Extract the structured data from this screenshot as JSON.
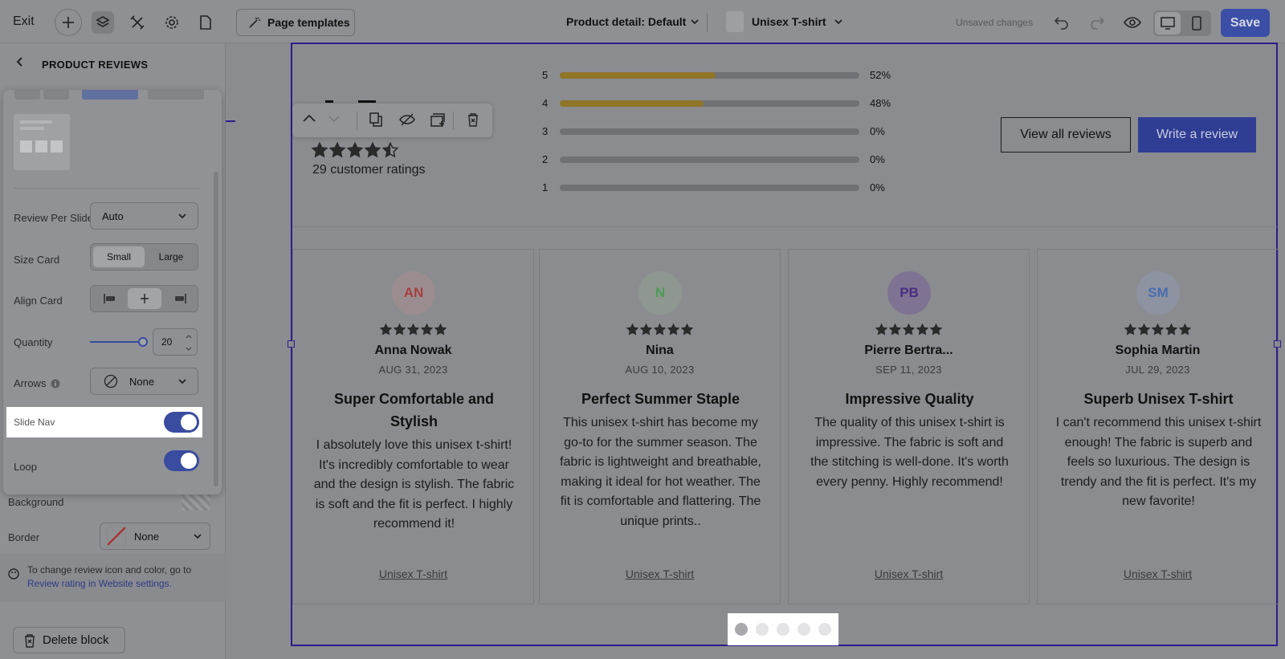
{
  "topbar": {
    "exit_label": "Exit",
    "page_templates_label": "Page templates",
    "page_select": "Product detail: Default",
    "product_select": "Unisex T-shirt",
    "unsaved_label": "Unsaved changes",
    "save_label": "Save"
  },
  "panel": {
    "title": "PRODUCT REVIEWS",
    "review_per_slide_label": "Review Per Slide",
    "review_per_slide_value": "Auto",
    "size_card_label": "Size Card",
    "size_options": [
      "Small",
      "Large"
    ],
    "size_selected": "Small",
    "align_card_label": "Align Card",
    "quantity_label": "Quantity",
    "quantity_value": "20",
    "quantity_fraction": 0.92,
    "arrows_label": "Arrows",
    "arrows_value": "None",
    "slide_nav_label": "Slide Nav",
    "slide_nav_on": true,
    "loop_label": "Loop",
    "loop_on": true,
    "background_label": "Background",
    "border_label": "Border",
    "border_value": "None",
    "info_text": "To change review icon and color, go to",
    "info_link": "Review rating in Website settings.",
    "delete_label": "Delete block"
  },
  "summary": {
    "average_stars": 4.5,
    "rating_count_text": "29 customer ratings",
    "distribution": [
      {
        "star": "5",
        "fraction": 0.52,
        "pct": "52%"
      },
      {
        "star": "4",
        "fraction": 0.48,
        "pct": "48%"
      },
      {
        "star": "3",
        "fraction": 0,
        "pct": "0%"
      },
      {
        "star": "2",
        "fraction": 0,
        "pct": "0%"
      },
      {
        "star": "1",
        "fraction": 0,
        "pct": "0%"
      }
    ],
    "view_all_label": "View all reviews",
    "write_review_label": "Write a review"
  },
  "reviews": [
    {
      "initials": "AN",
      "avatar_bg": "#9b8d8f",
      "avatar_fg": "#a8403e",
      "stars": 5,
      "name": "Anna Nowak",
      "date": "AUG 31, 2023",
      "title": "Super Comfortable and Stylish",
      "body": "I absolutely love this unisex t-shirt! It's incredibly comfortable to wear and the design is stylish. The fabric is soft and the fit is perfect. I highly recommend it!",
      "product": "Unisex T-shirt"
    },
    {
      "initials": "N",
      "avatar_bg": "#8e9890",
      "avatar_fg": "#4f9a58",
      "stars": 5,
      "name": "Nina",
      "date": "AUG 10, 2023",
      "title": "Perfect Summer Staple",
      "body": "This unisex t-shirt has become my go-to for the summer season. The fabric is lightweight and breathable, making it ideal for hot weather. The fit is comfortable and flattering. The unique prints..",
      "product": "Unisex T-shirt"
    },
    {
      "initials": "PB",
      "avatar_bg": "#7e7392",
      "avatar_fg": "#4a2f83",
      "stars": 5,
      "name": "Pierre Bertra...",
      "date": "SEP 11, 2023",
      "title": "Impressive Quality",
      "body": "The quality of this unisex t-shirt is impressive. The fabric is soft and the stitching is well-done. It's worth every penny. Highly recommend!",
      "product": "Unisex T-shirt"
    },
    {
      "initials": "SM",
      "avatar_bg": "#8d93a0",
      "avatar_fg": "#4a6bb0",
      "stars": 5,
      "name": "Sophia Martin",
      "date": "JUL 29, 2023",
      "title": "Superb Unisex T-shirt",
      "body": "I can't recommend this unisex t-shirt enough! The fabric is superb and feels so luxurious. The design is trendy and the fit is perfect. It's my new favorite!",
      "product": "Unisex T-shirt"
    }
  ],
  "slide_nav": {
    "count": 5,
    "active": 0
  },
  "colors": {
    "accent": "#3b4fa6",
    "star": "#8f7526",
    "selection": "#2b1d8a"
  }
}
